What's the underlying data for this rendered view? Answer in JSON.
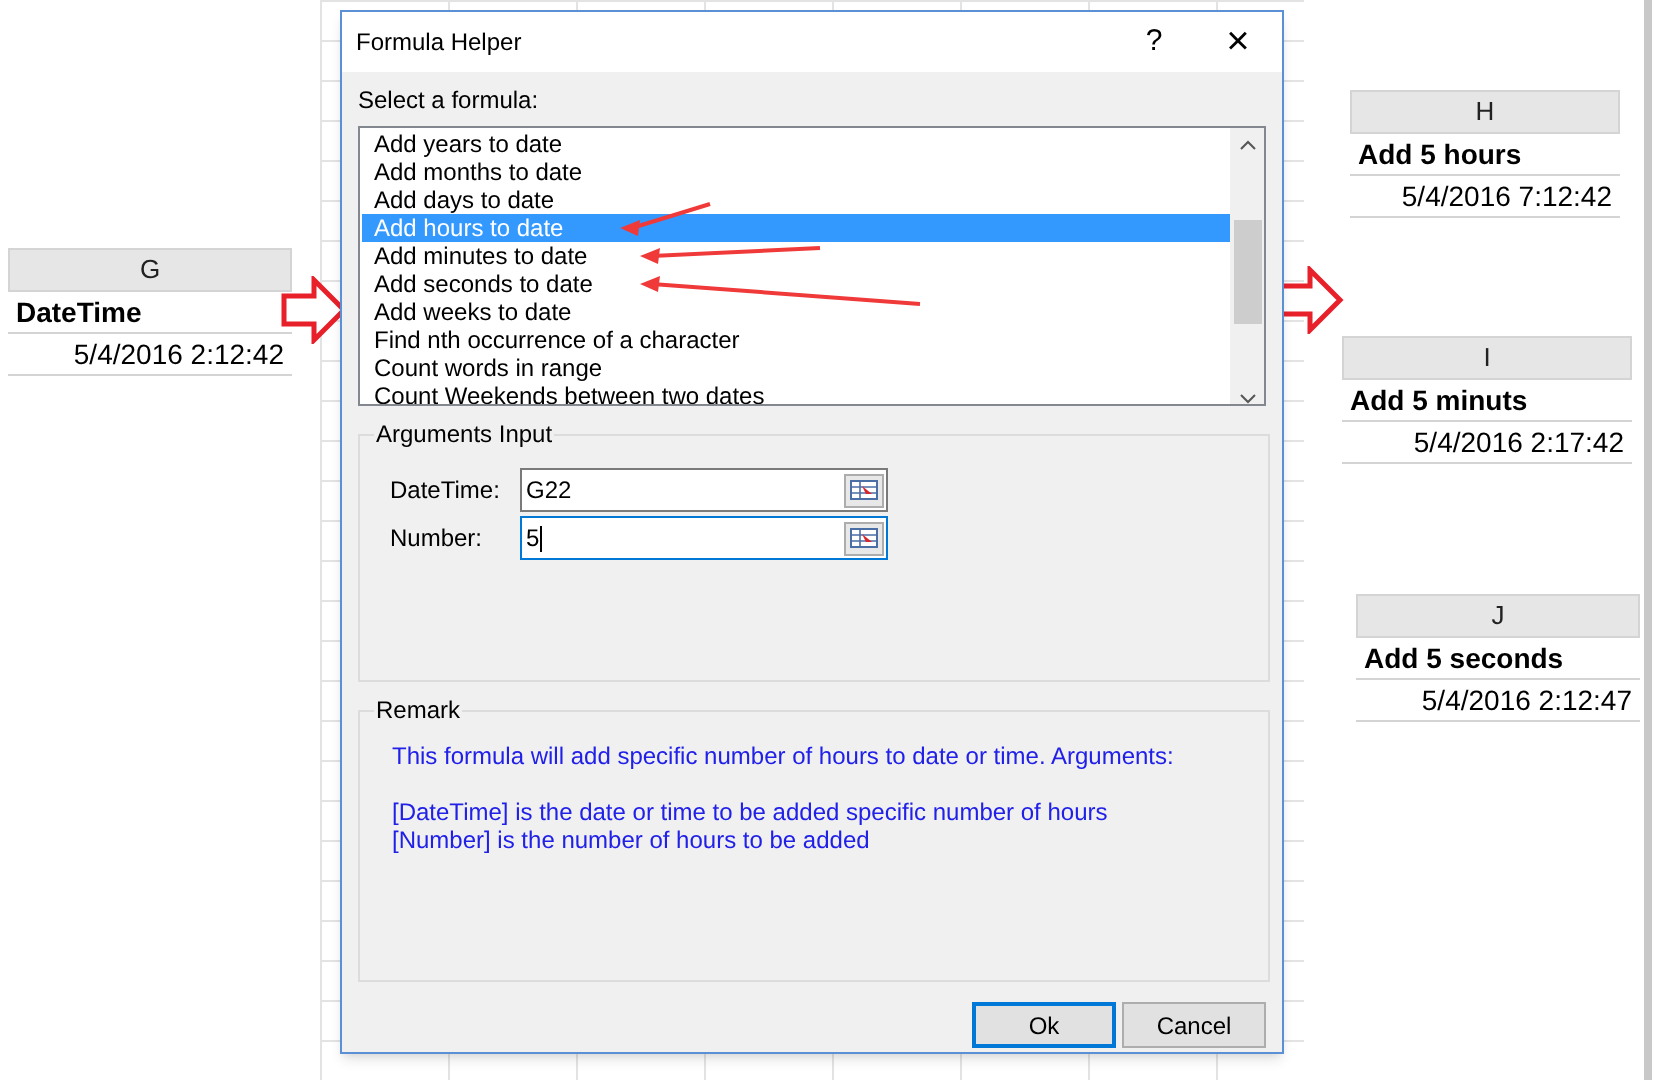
{
  "source_cell": {
    "column": "G",
    "header": "DateTime",
    "value": "5/4/2016 2:12:42"
  },
  "dialog": {
    "title": "Formula Helper",
    "help": "?",
    "close": "×",
    "list_label": "Select a formula:",
    "formulas": [
      {
        "label": "Add years to date",
        "selected": false,
        "marked": false
      },
      {
        "label": "Add months to date",
        "selected": false,
        "marked": false
      },
      {
        "label": "Add days to date",
        "selected": false,
        "marked": false
      },
      {
        "label": "Add hours to date",
        "selected": true,
        "marked": true
      },
      {
        "label": "Add minutes to date",
        "selected": false,
        "marked": true
      },
      {
        "label": "Add seconds to date",
        "selected": false,
        "marked": true
      },
      {
        "label": "Add weeks to date",
        "selected": false,
        "marked": false
      },
      {
        "label": "Find nth occurrence of a character",
        "selected": false,
        "marked": false
      },
      {
        "label": "Count words in range",
        "selected": false,
        "marked": false
      },
      {
        "label": "Count Weekends between two dates",
        "selected": false,
        "marked": false
      }
    ],
    "arguments": {
      "title": "Arguments Input",
      "fields": [
        {
          "label": "DateTime:",
          "value": "G22",
          "focused": false
        },
        {
          "label": "Number:",
          "value": "5",
          "focused": true
        }
      ]
    },
    "remark": {
      "title": "Remark",
      "intro": "This formula will add specific number of hours to date or time. Arguments:",
      "lines": [
        "[DateTime] is the date or time to be added specific number of hours",
        "[Number] is the number of hours to be added"
      ]
    },
    "buttons": [
      {
        "label": "Ok",
        "default": true
      },
      {
        "label": "Cancel",
        "default": false
      }
    ]
  },
  "result_cells": [
    {
      "column": "H",
      "header": "Add 5 hours",
      "value": "5/4/2016 7:12:42"
    },
    {
      "column": "I",
      "header": "Add 5 minuts",
      "value": "5/4/2016 2:17:42"
    },
    {
      "column": "J",
      "header": "Add 5 seconds",
      "value": "5/4/2016 2:12:47"
    }
  ]
}
